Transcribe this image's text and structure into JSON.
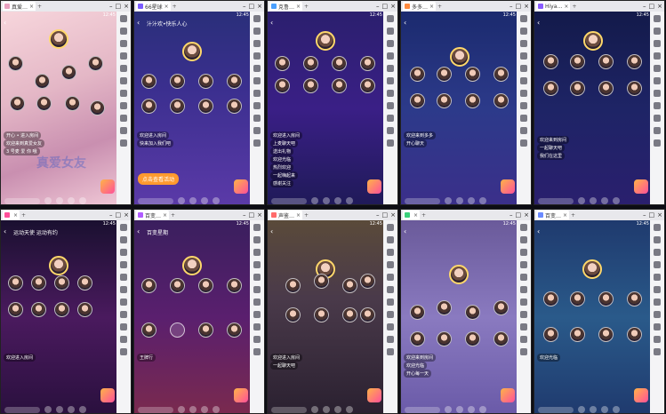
{
  "windows": [
    {
      "tab": "真爱…",
      "color": "#e8a0c0",
      "bg": "linear-gradient(160deg,#f7d6dc,#e4b7c6 40%,#c98fb0 70%,#f0c8d6)",
      "title": "",
      "chats": [
        "开心 • 进入房间",
        "欢迎来到真爱女友",
        "3 号麦 爱 你 哦"
      ],
      "watermark": "真爱女友"
    },
    {
      "tab": "66星球",
      "color": "#7b5cff",
      "bg": "linear-gradient(180deg,#2a2f7a,#3b2f8f 40%,#5b3aa8)",
      "title": "汁汁欢•快乐人心",
      "chats": [
        "欢迎进入房间",
        "快来加入我们吧"
      ],
      "banner": "点击查看活动",
      "watermark": ""
    },
    {
      "tab": "克鲁…",
      "color": "#4aa0ff",
      "bg": "linear-gradient(180deg,#2b1f6e,#3a1f86 50%,#1f1a58)",
      "title": "",
      "chats": [
        "欢迎进入房间",
        "上麦聊天吧",
        "送出礼物",
        "欢迎光临",
        "热烈欢迎",
        "一起嗨起来",
        "感谢关注"
      ],
      "watermark": ""
    },
    {
      "tab": "多多…",
      "color": "#ff8a3d",
      "bg": "linear-gradient(180deg,#1b2a6e,#2c3a8a 50%,#3b2f8a)",
      "title": "",
      "chats": [
        "欢迎来到多多",
        "开心聊天"
      ],
      "watermark": ""
    },
    {
      "tab": "Hiya…",
      "color": "#8a5cff",
      "bg": "linear-gradient(180deg,#131a4a,#1e2466 50%,#2a1f6e)",
      "title": "",
      "chats": [
        "欢迎来到房间",
        "一起聊天吧",
        "我们在这里"
      ],
      "watermark": ""
    },
    {
      "tab": "",
      "color": "#ff4f9a",
      "bg": "linear-gradient(180deg,#1a1030,#4a1a5e 50%,#2a103e)",
      "title": "运动天使 运动有约",
      "chats": [
        "欢迎进入房间"
      ],
      "watermark": ""
    },
    {
      "tab": "百变…",
      "color": "#b05cff",
      "bg": "linear-gradient(180deg,#3a1f5e,#5a1f6e 50%,#7a2a4e)",
      "title": "百变星期",
      "chats": [
        "王牌行"
      ],
      "watermark": ""
    },
    {
      "tab": "声鉴…",
      "color": "#ff6b6b",
      "bg": "linear-gradient(180deg,#5a4a3a,#4a3a4a 40%,#2a2030)",
      "title": "",
      "chats": [
        "欢迎进入房间",
        "一起聊天吧"
      ],
      "watermark": ""
    },
    {
      "tab": "",
      "color": "#3ad07a",
      "bg": "linear-gradient(180deg,#6a5a9a,#8a7ac0 50%,#6a5aa8)",
      "title": "",
      "chats": [
        "欢迎来到房间",
        "欢迎光临",
        "开心每一天"
      ],
      "watermark": ""
    },
    {
      "tab": "百变…",
      "color": "#6b8aff",
      "bg": "linear-gradient(180deg,#1f3a6e,#2a5a8a 50%,#1f3a6e)",
      "title": "",
      "chats": [
        "欢迎光临"
      ],
      "watermark": ""
    }
  ],
  "status_time": "12:45",
  "add_tab": "+",
  "icons": [
    "close-icon",
    "minimize-icon",
    "maximize-icon",
    "back-icon",
    "gift-icon",
    "mic-icon"
  ]
}
